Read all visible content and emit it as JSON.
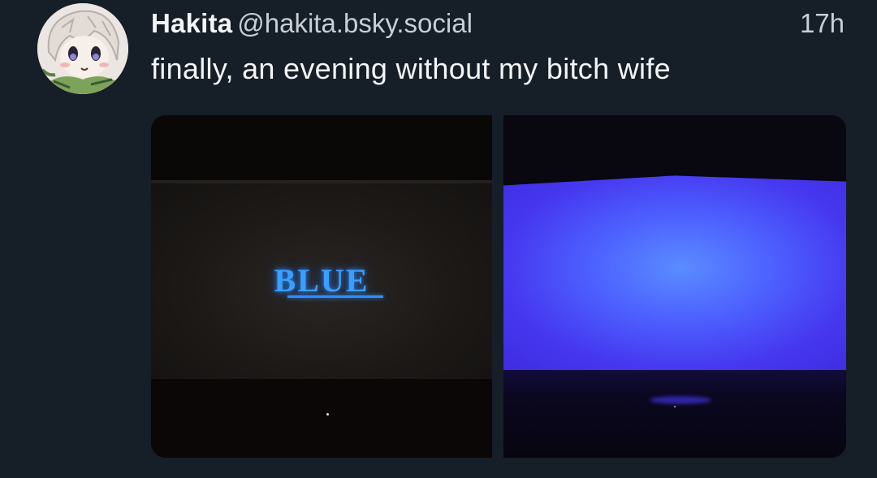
{
  "post": {
    "display_name": "Hakita",
    "handle": "@hakita.bsky.social",
    "timestamp": "17h",
    "text": "finally, an evening without my bitch wife"
  },
  "images": {
    "left": {
      "screen_text": "BLUE"
    },
    "right": {}
  },
  "colors": {
    "background": "#161e27",
    "blue_text": "#3aa0ff",
    "blue_screen": "#4d62ff"
  }
}
